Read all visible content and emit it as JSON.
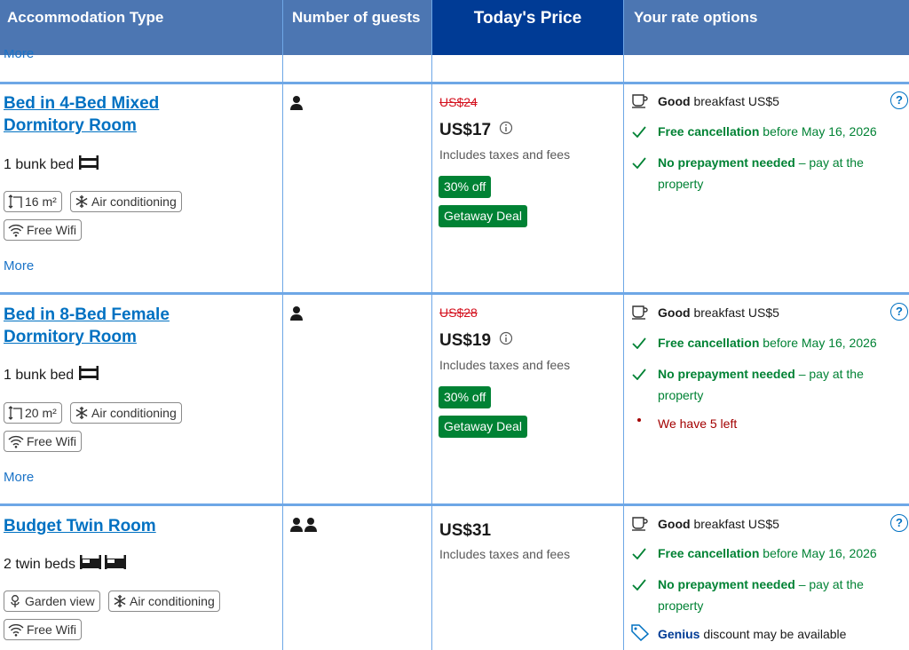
{
  "header": {
    "col_type": "Accommodation Type",
    "col_guests": "Number of guests",
    "col_price": "Today's Price",
    "col_options": "Your rate options"
  },
  "top_more": "More",
  "rooms": [
    {
      "name_line1": "Bed in 4-Bed Mixed",
      "name_line2": "Dormitory Room",
      "bed": "1 bunk bed",
      "chips": [
        "16 m²",
        "Air conditioning",
        "Free Wifi"
      ],
      "more": "More",
      "guests": 1,
      "old_price": "US$24",
      "price": "US$17",
      "taxes": "Includes taxes and fees",
      "discount": "30% off",
      "deal": "Getaway Deal",
      "breakfast_good": "Good",
      "breakfast_rest": "breakfast US$5",
      "cancel_bold": "Free cancellation",
      "cancel_rest": "before May 16, 2026",
      "prepay_bold": "No prepayment needed",
      "prepay_rest": "– pay at the",
      "prepay_line2": "property"
    },
    {
      "name_line1": "Bed in 8-Bed Female",
      "name_line2": "Dormitory Room",
      "bed": "1 bunk bed",
      "chips": [
        "20 m²",
        "Air conditioning",
        "Free Wifi"
      ],
      "more": "More",
      "guests": 1,
      "old_price": "US$28",
      "price": "US$19",
      "taxes": "Includes taxes and fees",
      "discount": "30% off",
      "deal": "Getaway Deal",
      "breakfast_good": "Good",
      "breakfast_rest": "breakfast US$5",
      "cancel_bold": "Free cancellation",
      "cancel_rest": "before May 16, 2026",
      "prepay_bold": "No prepayment needed",
      "prepay_rest": "– pay at the",
      "prepay_line2": "property",
      "scarcity": "We have 5 left"
    },
    {
      "name_line1": "Budget Twin Room",
      "bed": "2 twin beds",
      "chips": [
        "Garden view",
        "Air conditioning",
        "Free Wifi"
      ],
      "guests": 2,
      "price": "US$31",
      "taxes": "Includes taxes and fees",
      "breakfast_good": "Good",
      "breakfast_rest": "breakfast US$5",
      "cancel_bold": "Free cancellation",
      "cancel_rest": "before May 16, 2026",
      "prepay_bold": "No prepayment needed",
      "prepay_rest": "– pay at the",
      "prepay_line2": "property",
      "genius_bold": "Genius",
      "genius_rest": "discount may be available"
    }
  ],
  "help_symbol": "?",
  "colors": {
    "header_bg": "#4c76b2",
    "price_header_bg": "#003b95",
    "link": "#0071c2",
    "green": "#008234",
    "red": "#d4111e"
  }
}
